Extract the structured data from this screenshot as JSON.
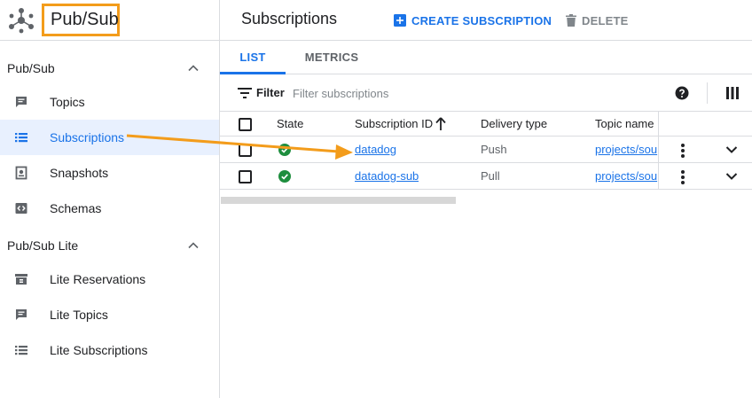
{
  "brand": {
    "title": "Pub/Sub",
    "icon": "pubsub-hub-icon"
  },
  "sidebar": {
    "sections": [
      {
        "label": "Pub/Sub",
        "items": [
          {
            "label": "Topics",
            "icon": "topic-message-icon"
          },
          {
            "label": "Subscriptions",
            "icon": "list-icon",
            "active": true
          },
          {
            "label": "Snapshots",
            "icon": "snapshot-icon"
          },
          {
            "label": "Schemas",
            "icon": "code-icon"
          }
        ]
      },
      {
        "label": "Pub/Sub Lite",
        "items": [
          {
            "label": "Lite Reservations",
            "icon": "reservation-icon"
          },
          {
            "label": "Lite Topics",
            "icon": "topic-message-icon"
          },
          {
            "label": "Lite Subscriptions",
            "icon": "list-icon"
          }
        ]
      }
    ]
  },
  "header": {
    "title": "Subscriptions",
    "create_label": "CREATE SUBSCRIPTION",
    "delete_label": "DELETE"
  },
  "tabs": [
    {
      "label": "LIST",
      "active": true
    },
    {
      "label": "METRICS"
    }
  ],
  "filter": {
    "label": "Filter",
    "placeholder": "Filter subscriptions"
  },
  "table": {
    "columns": [
      "State",
      "Subscription ID",
      "Delivery type",
      "Topic name"
    ],
    "sort": {
      "column": "Subscription ID",
      "direction": "ascending"
    },
    "rows": [
      {
        "state": "ok",
        "id": "datadog",
        "delivery": "Push",
        "topic": "projects/sou"
      },
      {
        "state": "ok",
        "id": "datadog-sub",
        "delivery": "Pull",
        "topic": "projects/sou"
      }
    ]
  },
  "colors": {
    "accent": "#1a73e8",
    "highlight": "#f39c1b",
    "success": "#1e8e3e",
    "active_bg": "#e8f0fe"
  }
}
